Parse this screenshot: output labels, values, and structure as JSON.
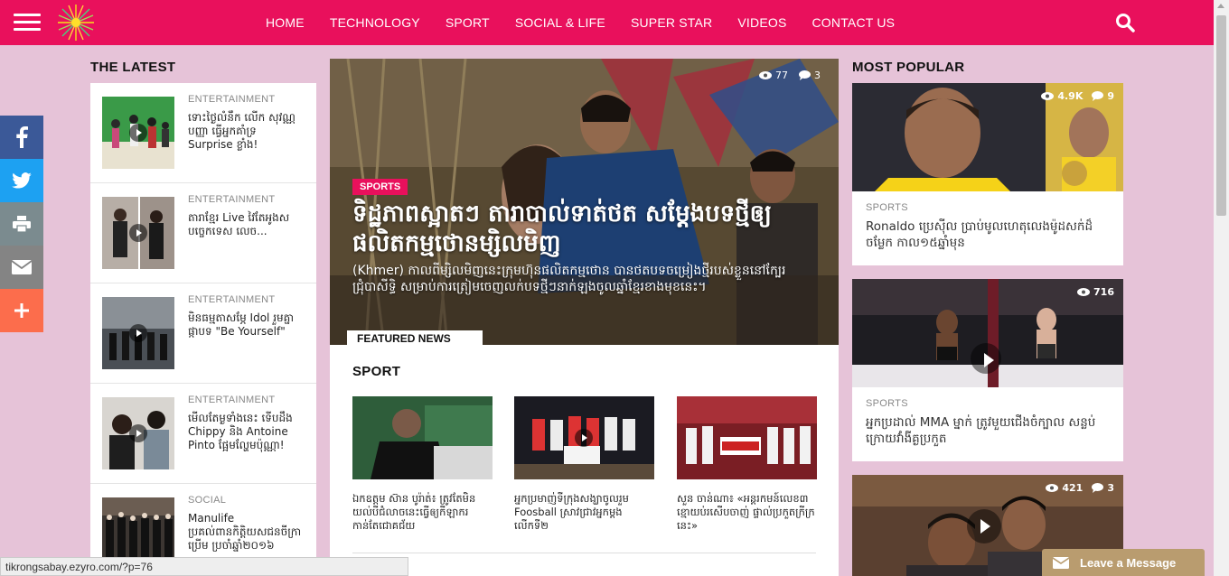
{
  "header": {
    "nav": [
      "HOME",
      "TECHNOLOGY",
      "SPORT",
      "SOCIAL & LIFE",
      "SUPER STAR",
      "VIDEOS",
      "CONTACT US"
    ]
  },
  "sections": {
    "latest_title": "THE LATEST",
    "popular_title": "MOST POPULAR",
    "sport_title": "SPORT",
    "featured_label": "FEATURED NEWS"
  },
  "latest": [
    {
      "category": "ENTERTAINMENT",
      "text": "ទោះថ្ងៃលំនឹក លើក សុវណ្ណ បញ្ញា ធ្វើអ្នកគាំទ្រ Surprise ខ្លាំង!"
    },
    {
      "category": "ENTERTAINMENT",
      "text": "តារាខ្មែរ Live វៃតែអូងស បច្ចេកទេស លេច..."
    },
    {
      "category": "ENTERTAINMENT",
      "text": "មិនធម្មតាសម្ភែ Idol រួមគ្នាផ្កាបទ \"Be Yourself\""
    },
    {
      "category": "ENTERTAINMENT",
      "text": "មើលតែម្ងទាំងនេះ ទើបដឹង Chippy និង Antoine Pinto ផ្អែមល្ហែមប៉ុណ្ណា!"
    },
    {
      "category": "SOCIAL",
      "text": "Manulife ប្រគល់ពានកិត្តិយសជនចីក្រាប្រើម ប្រចាំឆ្នាំ២០១៦"
    }
  ],
  "hero": {
    "views": "77",
    "comments": "3",
    "badge": "SPORTS",
    "title": "ទិដ្ឋភាពស្អាតៗ តារាបាល់ទាត់ថត សម្ដែងបទថ្មីឲ្យផលិតកម្មថោនម្សិលមិញ",
    "excerpt": "(Khmer) កាលពីម្សិលមិញនេះក្រុមហ៊ុនផលិតកម្មថោន បានថតបទចម្រៀងថ្មីរបស់ខ្លួននៅក្បែរជ្រុំបាសីទ្ធិ សម្រាប់ការត្រៀមចេញលក់បទថ្មីៗនាក់ឡងចូលឆ្នាំខ្មែរខាងមុខនេះ។"
  },
  "sport": [
    {
      "text": "ឯកឧត្តម ស៊ាន បូរ៉ាត់៖ ត្រូវតែមិនយល់បីជំលាចនេះធ្វើឲ្យកីឡាករកាន់តែជោគជ័យ"
    },
    {
      "text": "អ្នកប្រមាញ់ទីក្រុងសង្ឃាចូលរួម Foosball ស្រាវជ្រាវអ្នកម្ដងលើកទី២"
    },
    {
      "text": "សួន ចាន់ណា៖ «អន្តរកមន៍លេខ៣ ខ្មោយប់រសើបចាញ់ ផ្ទាល់ប្រកួតក្រីក្រនេះ»"
    }
  ],
  "popular": [
    {
      "views": "4.9K",
      "comments": "9",
      "category": "SPORTS",
      "text": "Ronaldo ប្រេស៊ីល ប្រាប់មូលហេតុលេងម៉ូដសក់ដ៏ចម្លែក កាល១៥ឆ្នាំមុន"
    },
    {
      "views": "716",
      "category": "SPORTS",
      "text": "អ្នកប្រដាល់ MMA ម្នាក់ ត្រូវមួយជើងចំក្បាល សន្លប់ ក្រោយវាំងីគ្ងប្រកួត"
    },
    {
      "views": "421",
      "comments": "3"
    }
  ],
  "status_url": "tikrongsabay.ezyro.com/?p=76",
  "chat": {
    "label": "Leave a Message"
  }
}
